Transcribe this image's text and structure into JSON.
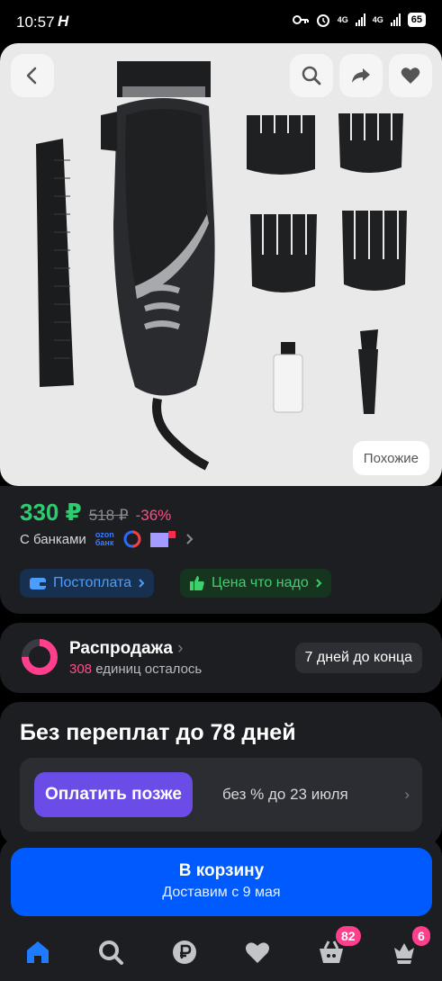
{
  "status": {
    "time": "10:57",
    "app_icon": "H",
    "net1": "4G",
    "net2": "4G",
    "battery": "65"
  },
  "hero": {
    "back_icon": "chevron-left-icon",
    "search_icon": "search-icon",
    "share_icon": "share-icon",
    "favorite_icon": "heart-icon",
    "similar_label": "Похожие"
  },
  "price": {
    "current": "330 ₽",
    "old": "518 ₽",
    "discount": "-36%",
    "banks_label": "С банками",
    "ozon_bank_line1": "ozon",
    "ozon_bank_line2": "банк",
    "postpay_label": "Постоплата",
    "good_price_label": "Цена что надо"
  },
  "sale": {
    "title": "Распродажа",
    "count": "308",
    "remaining": "единиц осталось",
    "days_label": "7 дней до конца",
    "progress_fraction": 0.75
  },
  "installments": {
    "title": "Без переплат до 78 дней",
    "button": "Оплатить позже",
    "text": "без % до 23 июля"
  },
  "cart": {
    "label": "В корзину",
    "delivery": "Доставим с 9 мая"
  },
  "nav": {
    "items": [
      {
        "icon": "home-icon"
      },
      {
        "icon": "search-icon"
      },
      {
        "icon": "ruble-icon"
      },
      {
        "icon": "heart-icon"
      },
      {
        "icon": "cart-icon",
        "badge": "82"
      },
      {
        "icon": "profile-icon",
        "badge": "6"
      }
    ]
  },
  "colors": {
    "accent": "#005bff",
    "price": "#2ecc71",
    "discount": "#ff4d88",
    "pay_later": "#6b4ce6"
  }
}
